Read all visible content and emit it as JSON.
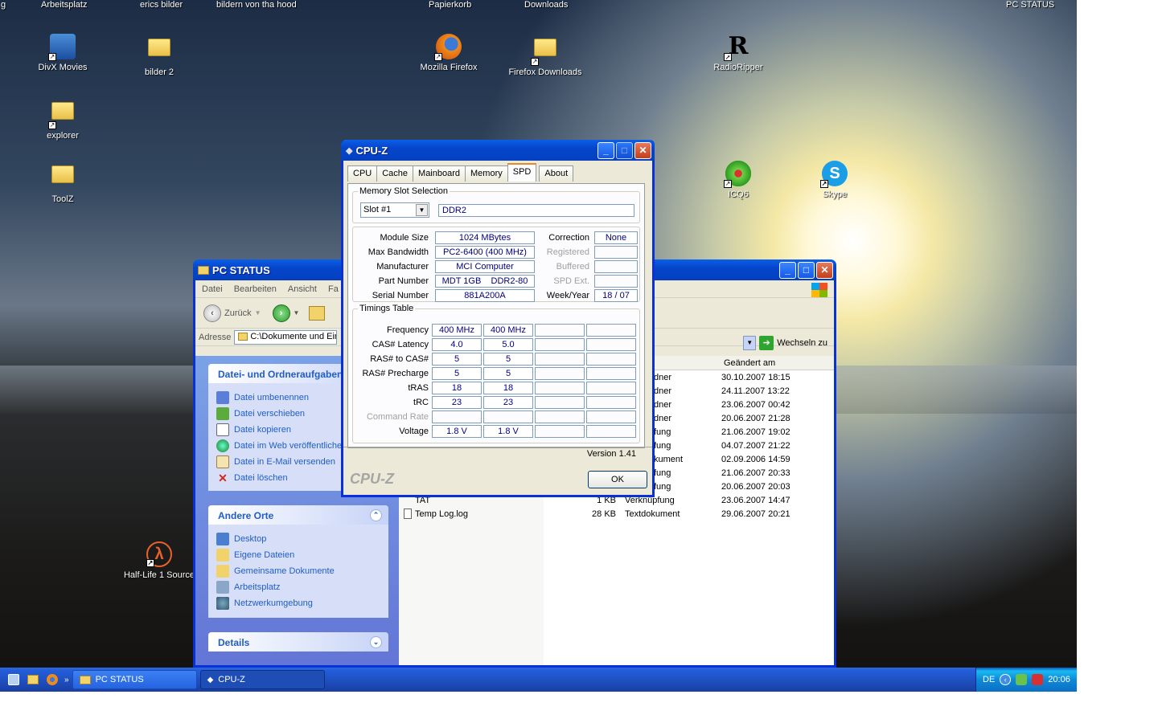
{
  "desktop": {
    "top_labels": [
      "g",
      "Arbeitsplatz",
      "erics bilder",
      "bildern von tha hood",
      "Papierkorb",
      "Downloads",
      "PC STATUS"
    ],
    "icons": {
      "divx": "DivX Movies",
      "bilder2": "bilder 2",
      "firefox": "Mozilla Firefox",
      "ffdownloads": "Firefox Downloads",
      "radioripper": "RadioRipper",
      "explorer": "explorer",
      "toolz": "ToolZ",
      "icq": "ICQ6",
      "skype": "Skype",
      "halflife": "Half-Life 1 Source"
    }
  },
  "explorer": {
    "title": "PC STATUS",
    "menu": [
      "Datei",
      "Bearbeiten",
      "Ansicht",
      "Fa"
    ],
    "back_label": "Zurück",
    "address_label": "Adresse",
    "address_value": "C:\\Dokumente und Eins",
    "go_label": "Wechseln zu",
    "column_modified": "Geändert am",
    "file_tasks": {
      "title": "Datei- und Ordneraufgaben",
      "items": [
        "Datei umbenennen",
        "Datei verschieben",
        "Datei kopieren",
        "Datei im Web veröffentliche",
        "Datei in E-Mail versenden",
        "Datei löschen"
      ]
    },
    "other_places": {
      "title": "Andere Orte",
      "items": [
        "Desktop",
        "Eigene Dateien",
        "Gemeinsame Dokumente",
        "Arbeitsplatz",
        "Netzwerkumgebung"
      ]
    },
    "details_title": "Details",
    "files": [
      {
        "type": "dner",
        "date": "30.10.2007 18:15"
      },
      {
        "type": "dner",
        "date": "24.11.2007 13:22"
      },
      {
        "type": "dner",
        "date": "23.06.2007 00:42"
      },
      {
        "type": "dner",
        "date": "20.06.2007 21:28"
      },
      {
        "type": "fung",
        "date": "21.06.2007 19:02"
      },
      {
        "type": "fung",
        "date": "04.07.2007 21:22"
      },
      {
        "type": "kument",
        "date": "02.09.2006 14:59"
      },
      {
        "type": "fung",
        "date": "21.06.2007 20:33"
      },
      {
        "type": "fung",
        "date": "20.06.2007 20:03"
      },
      {
        "name": "TAT",
        "size": "1 KB",
        "type": "Verknüpfung",
        "date": "23.06.2007 14:47"
      },
      {
        "name": "Temp Log.log",
        "size": "28 KB",
        "type": "Textdokument",
        "date": "29.06.2007 20:21"
      }
    ]
  },
  "cpuz": {
    "title": "CPU-Z",
    "tabs": [
      "CPU",
      "Cache",
      "Mainboard",
      "Memory",
      "SPD",
      "About"
    ],
    "slot_group": "Memory Slot Selection",
    "slot": "Slot #1",
    "mem_type": "DDR2",
    "fields": {
      "module_size_label": "Module Size",
      "module_size": "1024 MBytes",
      "max_bw_label": "Max Bandwidth",
      "max_bw": "PC2-6400 (400 MHz)",
      "manufacturer_label": "Manufacturer",
      "manufacturer": "MCI Computer",
      "part_label": "Part Number",
      "part": "MDT 1GB    DDR2-80",
      "serial_label": "Serial Number",
      "serial": "881A200A",
      "correction_label": "Correction",
      "correction": "None",
      "registered_label": "Registered",
      "buffered_label": "Buffered",
      "spd_ext_label": "SPD Ext.",
      "week_year_label": "Week/Year",
      "week_year": "18 / 07"
    },
    "timings_group": "Timings Table",
    "timings": [
      {
        "label": "Frequency",
        "c1": "400 MHz",
        "c2": "400 MHz"
      },
      {
        "label": "CAS# Latency",
        "c1": "4.0",
        "c2": "5.0"
      },
      {
        "label": "RAS# to CAS#",
        "c1": "5",
        "c2": "5"
      },
      {
        "label": "RAS# Precharge",
        "c1": "5",
        "c2": "5"
      },
      {
        "label": "tRAS",
        "c1": "18",
        "c2": "18"
      },
      {
        "label": "tRC",
        "c1": "23",
        "c2": "23"
      },
      {
        "label": "Command Rate",
        "c1": "",
        "c2": ""
      },
      {
        "label": "Voltage",
        "c1": "1.8 V",
        "c2": "1.8 V"
      }
    ],
    "version": "Version 1.41",
    "brand": "CPU-Z",
    "ok": "OK"
  },
  "taskbar": {
    "items": [
      "PC STATUS",
      "CPU-Z"
    ],
    "lang": "DE",
    "clock": "20:06"
  },
  "colors": {
    "xp_blue": "#0831d9",
    "link_blue": "#215dc6",
    "cpuz_value": "#000080"
  }
}
